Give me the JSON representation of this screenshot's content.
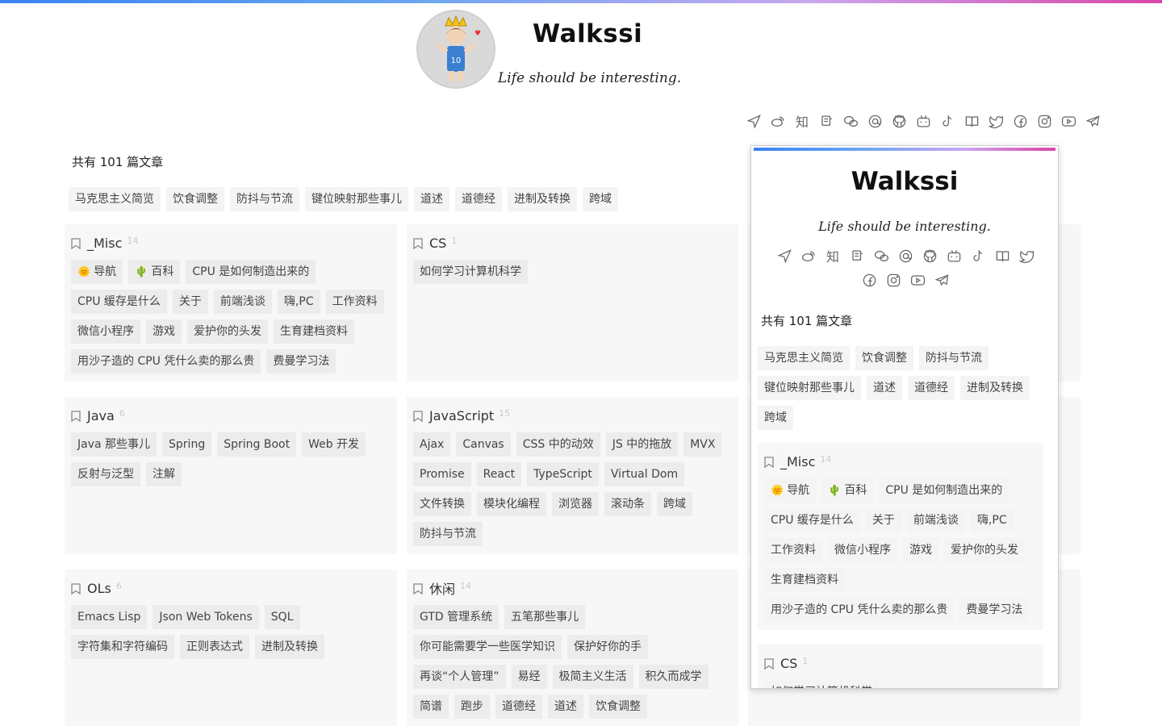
{
  "site": {
    "title": "Walkssi",
    "motto": "Life should be interesting."
  },
  "social_icons": [
    "send-icon",
    "weibo-icon",
    "zhihu-icon",
    "douban-icon",
    "wechat-icon",
    "email-icon",
    "github-icon",
    "bilibili-icon",
    "tiktok-icon",
    "book-icon",
    "twitter-icon",
    "facebook-icon",
    "instagram-icon",
    "youtube-icon",
    "telegram-icon"
  ],
  "social_glyphs": {
    "zhihu-icon": "知"
  },
  "summary": {
    "article_count_text": "共有 101 篇文章"
  },
  "recent_tags": [
    "马克思主义简览",
    "饮食调整",
    "防抖与节流",
    "键位映射那些事儿",
    "道述",
    "道德经",
    "进制及转换",
    "跨域"
  ],
  "categories": [
    {
      "name": "_Misc",
      "count": "14",
      "items": [
        {
          "label": "导航",
          "emoji": "🌞"
        },
        {
          "label": "百科",
          "emoji": "🌵"
        },
        {
          "label": "CPU 是如何制造出来的"
        },
        {
          "label": "CPU 缓存是什么"
        },
        {
          "label": "关于"
        },
        {
          "label": "前端浅谈"
        },
        {
          "label": "嗨,PC"
        },
        {
          "label": "工作资料"
        },
        {
          "label": "微信小程序"
        },
        {
          "label": "游戏"
        },
        {
          "label": "爱护你的头发"
        },
        {
          "label": "生育建档资料"
        },
        {
          "label": "用沙子造的 CPU 凭什么卖的那么贵"
        },
        {
          "label": "费曼学习法"
        }
      ]
    },
    {
      "name": "CS",
      "count": "1",
      "items": [
        {
          "label": "如何学习计算机科学"
        }
      ]
    },
    {
      "name": "Java",
      "count": "6",
      "items": [
        {
          "label": "Java 那些事儿"
        },
        {
          "label": "Spring"
        },
        {
          "label": "Spring Boot"
        },
        {
          "label": "Web 开发"
        },
        {
          "label": "反射与泛型"
        },
        {
          "label": "注解"
        }
      ]
    },
    {
      "name": "JavaScript",
      "count": "15",
      "items": [
        {
          "label": "Ajax"
        },
        {
          "label": "Canvas"
        },
        {
          "label": "CSS 中的动效"
        },
        {
          "label": "JS 中的拖放"
        },
        {
          "label": "MVX"
        },
        {
          "label": "Promise"
        },
        {
          "label": "React"
        },
        {
          "label": "TypeScript"
        },
        {
          "label": "Virtual Dom"
        },
        {
          "label": "文件转换"
        },
        {
          "label": "模块化编程"
        },
        {
          "label": "浏览器"
        },
        {
          "label": "滚动条"
        },
        {
          "label": "跨域"
        },
        {
          "label": "防抖与节流"
        }
      ]
    },
    {
      "name": "OLs",
      "count": "6",
      "items": [
        {
          "label": "Emacs Lisp"
        },
        {
          "label": "Json Web Tokens"
        },
        {
          "label": "SQL"
        },
        {
          "label": "字符集和字符编码"
        },
        {
          "label": "正则表达式"
        },
        {
          "label": "进制及转换"
        }
      ]
    },
    {
      "name": "休闲",
      "count": "14",
      "items": [
        {
          "label": "GTD 管理系统"
        },
        {
          "label": "五笔那些事儿"
        },
        {
          "label": "你可能需要学一些医学知识"
        },
        {
          "label": "保护好你的手"
        },
        {
          "label": "再谈“个人管理”"
        },
        {
          "label": "易经"
        },
        {
          "label": "极简主义生活"
        },
        {
          "label": "积久而成学"
        },
        {
          "label": "简谱"
        },
        {
          "label": "跑步"
        },
        {
          "label": "道德经"
        },
        {
          "label": "道述"
        },
        {
          "label": "饮食调整"
        }
      ]
    }
  ]
}
